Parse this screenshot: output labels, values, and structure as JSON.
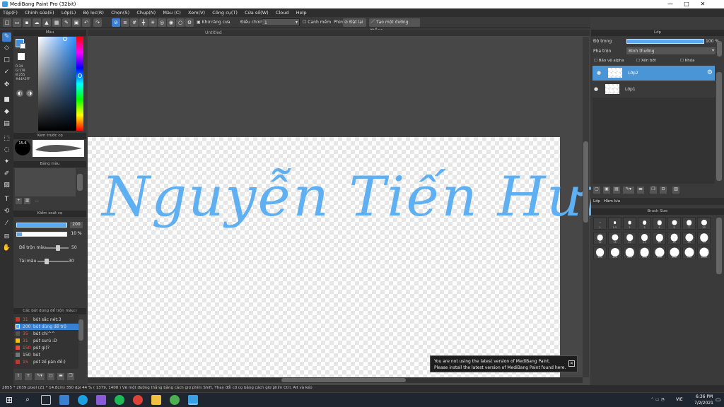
{
  "window": {
    "title": "MediBang Paint Pro (32bit)",
    "minimize": "—",
    "maximize": "□",
    "close": "✕"
  },
  "menu": [
    "Tệp(F)",
    "Chỉnh sửa(E)",
    "Lớp(L)",
    "Bộ lọc(R)",
    "Chọn(S)",
    "Chụp(N)",
    "Màu (C)",
    "Xem(V)",
    "Công cụ(T)",
    "Cửa sổ(W)",
    "Cloud",
    "Help"
  ],
  "toolbar": {
    "antialias": "Khử răng cưa",
    "correction_label": "Điều chỉnh",
    "correction_value": "1",
    "snap_label": "Canh mềm",
    "pen_label": "Phim",
    "off_label": "Đặt lại",
    "create_line": "Tạo một đường thẳng"
  },
  "color_panel": {
    "title": "Màu",
    "r": "R:34",
    "g": "G:178",
    "b": "B:255",
    "hex": "#44A5FF",
    "fg": "#3a8fe6",
    "bg": "#ffffff"
  },
  "brush_preview": {
    "title": "Xem trước cọ",
    "size": "15.6"
  },
  "palette": {
    "title": "Bảng màu"
  },
  "brush_control": {
    "title": "Kiểm soát cọ",
    "size_value": "200",
    "opacity_value": "10 %",
    "blend_label": "Để trộn màu",
    "blend_value": "50",
    "load_label": "Tải màu",
    "load_value": "30"
  },
  "brush_list": {
    "title": "Các bút dùng để trộn màu:)",
    "items": [
      {
        "num": "31",
        "label": "bút sắc nét:3",
        "color": "#c0392b",
        "selected": false
      },
      {
        "num": "200",
        "label": "bút dùng để trộ",
        "color": "#4aa8ff",
        "selected": true
      },
      {
        "num": "35",
        "label": "bút chì^^",
        "color": "#555555",
        "selected": false
      },
      {
        "num": "31",
        "label": "pút surú :D",
        "color": "#f1c40f",
        "selected": false
      },
      {
        "num": "150",
        "label": "pút gì)?",
        "color": "#e74c3c",
        "selected": false
      },
      {
        "num": "150",
        "label": "bút",
        "color": "#777777",
        "selected": false
      },
      {
        "num": "15",
        "label": "pút zế pàn đồ:)",
        "color": "#c0392b",
        "selected": false
      }
    ]
  },
  "document": {
    "tab": "Untitled",
    "text": "Nguyễn Tiến Hưng"
  },
  "toast": {
    "line1": "You are not using the latest version of MediBang Paint.",
    "line2": "Please install the latest version of MediBang Paint found here.",
    "close": "✕"
  },
  "layers": {
    "title": "Lớp",
    "opacity_label": "Độ trong",
    "opacity_value": "100 %",
    "blend_label": "Pha trộn",
    "blend_value": "Bình thường",
    "protect_alpha": "Bảo vệ alpha",
    "clipping": "Xén bớt",
    "lock": "Khóa",
    "items": [
      {
        "name": "Lớp2",
        "selected": true
      },
      {
        "name": "Lớp1",
        "selected": false
      }
    ],
    "tabs": [
      "Lớp",
      "Hàm lưu"
    ]
  },
  "brush_size": {
    "title": "Brush Size",
    "labels": [
      "1",
      "1.5",
      "2",
      "3",
      "4",
      "5",
      "7",
      "10",
      "12",
      "15",
      "20",
      "25",
      "30",
      "40",
      "50",
      "70",
      "100",
      "150",
      "200",
      "300",
      "400",
      "500",
      "700",
      "1000"
    ]
  },
  "status": {
    "text": "2855 * 2039 pixel  (21 * 14.8cm)  350 dpi  44 %  ( 1379, 1408 )  Vẽ một đường thẳng bằng cách giữ phím Shift, Thay đổi cỡ cọ bằng cách giữ phím Ctrl, Alt và kéo"
  },
  "taskbar": {
    "time": "6:36 PM",
    "date": "7/2/2021",
    "lang": "VIE"
  }
}
